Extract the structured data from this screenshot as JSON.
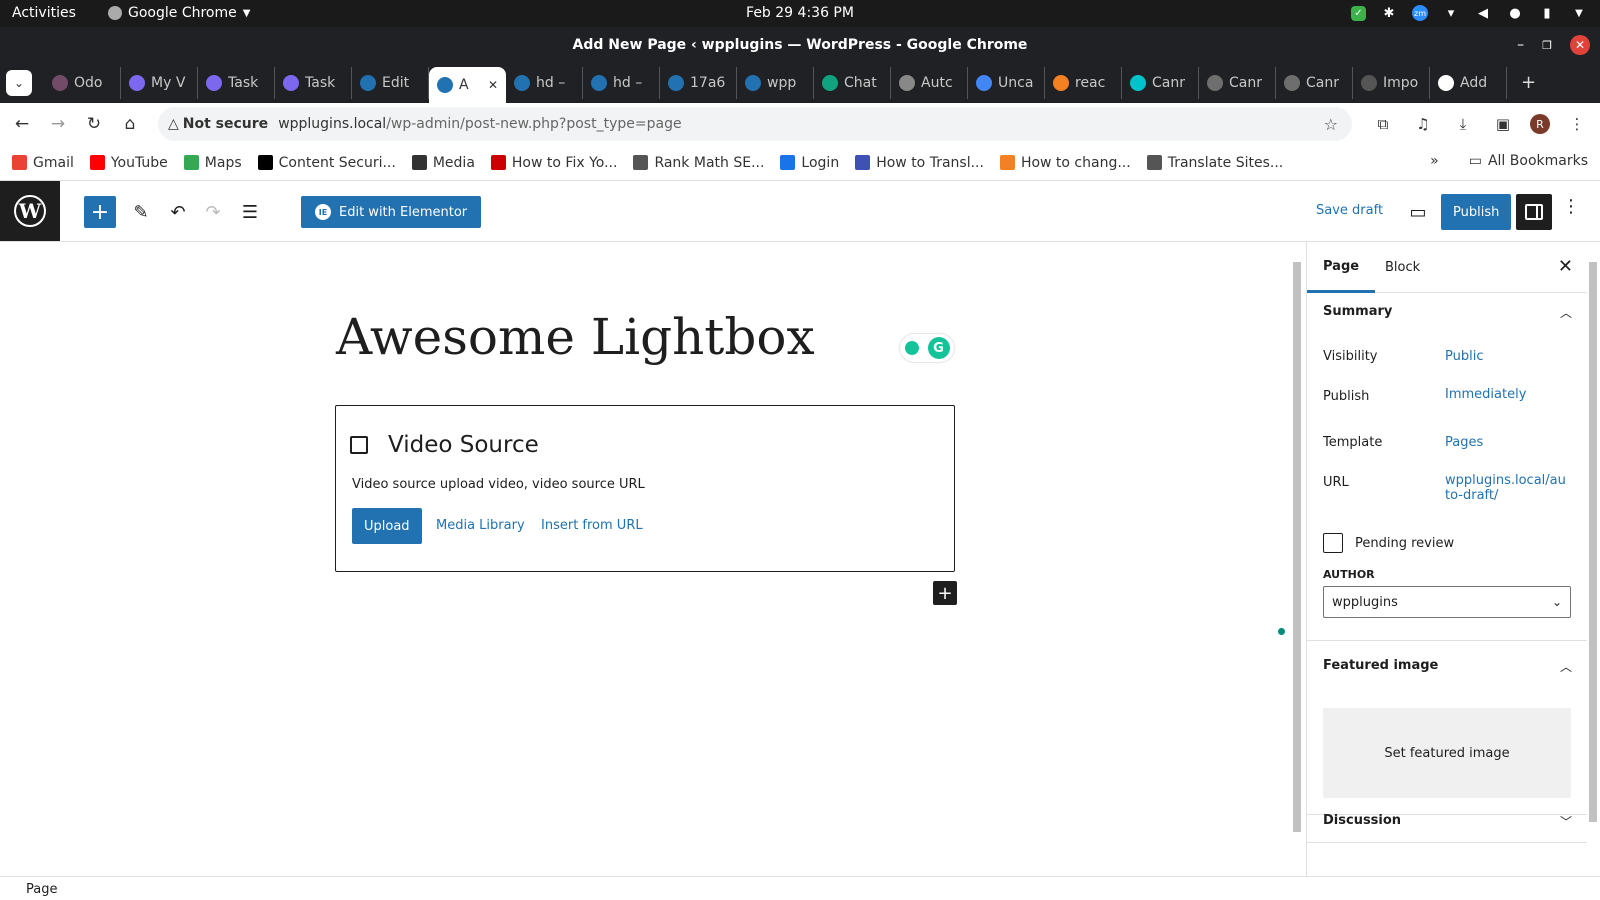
{
  "os_bar": {
    "activities": "Activities",
    "app_name": "Google Chrome",
    "clock": "Feb 29  4:36 PM"
  },
  "window": {
    "title": "Add New Page ‹ wpplugins — WordPress - Google Chrome"
  },
  "tabs": [
    {
      "label": "Odo",
      "icon": "odoo-icon",
      "color": "#714b67"
    },
    {
      "label": "My V",
      "icon": "clickup-icon",
      "color": "#7b68ee"
    },
    {
      "label": "Task",
      "icon": "clickup-icon",
      "color": "#7b68ee"
    },
    {
      "label": "Task",
      "icon": "clickup-icon",
      "color": "#7b68ee"
    },
    {
      "label": "Edit",
      "icon": "wordpress-icon",
      "color": "#2271b1"
    },
    {
      "label": "A",
      "icon": "wordpress-icon",
      "color": "#2271b1",
      "active": true
    },
    {
      "label": "hd –",
      "icon": "wordpress-icon",
      "color": "#2271b1"
    },
    {
      "label": "hd –",
      "icon": "wordpress-icon",
      "color": "#2271b1"
    },
    {
      "label": "17a6",
      "icon": "wordpress-icon",
      "color": "#2271b1"
    },
    {
      "label": "wpp",
      "icon": "wordpress-icon",
      "color": "#2271b1"
    },
    {
      "label": "Chat",
      "icon": "chatgpt-icon",
      "color": "#10a37f"
    },
    {
      "label": "Autc",
      "icon": "wordpress-icon",
      "color": "#888888"
    },
    {
      "label": "Unca",
      "icon": "google-icon",
      "color": "#4285f4"
    },
    {
      "label": "reac",
      "icon": "stackoverflow-icon",
      "color": "#f48024"
    },
    {
      "label": "Canr",
      "icon": "canva-icon",
      "color": "#00c4cc"
    },
    {
      "label": "Canr",
      "icon": "github-icon",
      "color": "#6e6e6e"
    },
    {
      "label": "Canr",
      "icon": "github-icon",
      "color": "#6e6e6e"
    },
    {
      "label": "Impo",
      "icon": "feather-icon",
      "color": "#555555"
    },
    {
      "label": "Add",
      "icon": "add-icon",
      "color": "#ffffff"
    }
  ],
  "omnibox": {
    "security_label": "Not secure",
    "url_host": "wpplugins.local",
    "url_path": "/wp-admin/post-new.php?post_type=page"
  },
  "bookmarks": [
    {
      "label": "Gmail",
      "icon": "gmail-icon",
      "color": "#ea4335"
    },
    {
      "label": "YouTube",
      "icon": "youtube-icon",
      "color": "#ff0000"
    },
    {
      "label": "Maps",
      "icon": "maps-icon",
      "color": "#34a853"
    },
    {
      "label": "Content Securi...",
      "icon": "medium-icon",
      "color": "#000000"
    },
    {
      "label": "Media",
      "icon": "media-icon",
      "color": "#333333"
    },
    {
      "label": "How to Fix Yo...",
      "icon": "bookmark-icon",
      "color": "#cc0000"
    },
    {
      "label": "Rank Math SE...",
      "icon": "is-icon",
      "color": "#555555"
    },
    {
      "label": "Login",
      "icon": "grid-icon",
      "color": "#1a73e8"
    },
    {
      "label": "How to Transl...",
      "icon": "translate-icon",
      "color": "#3f51b5"
    },
    {
      "label": "How to chang...",
      "icon": "stackoverflow-icon",
      "color": "#f48024"
    },
    {
      "label": "Translate Sites...",
      "icon": "loading-icon",
      "color": "#555555"
    }
  ],
  "bookmarks_right": {
    "more": "»",
    "all_bookmarks": "All Bookmarks"
  },
  "wp_toolbar": {
    "elementor_label": "Edit with Elementor",
    "save_draft": "Save draft",
    "publish": "Publish"
  },
  "editor": {
    "page_title": "Awesome Lightbox",
    "block": {
      "title": "Video Source",
      "description": "Video source upload video, video source URL",
      "upload": "Upload",
      "media_library": "Media Library",
      "insert_url": "Insert from URL"
    }
  },
  "sidebar": {
    "tab_page": "Page",
    "tab_block": "Block",
    "summary": "Summary",
    "rows": {
      "visibility_label": "Visibility",
      "visibility_value": "Public",
      "publish_label": "Publish",
      "publish_value": "Immediately",
      "template_label": "Template",
      "template_value": "Pages",
      "url_label": "URL",
      "url_value_line1": "wpplugins.local/au",
      "url_value_line2": "to-draft/"
    },
    "pending_review": "Pending review",
    "author_label": "AUTHOR",
    "author_value": "wpplugins",
    "featured_image": "Featured image",
    "set_featured_image": "Set featured image",
    "discussion": "Discussion"
  },
  "status_bar": {
    "breadcrumb": "Page"
  },
  "colors": {
    "wp_blue": "#2271b1",
    "dark": "#1e1e1e",
    "chrome_dark": "#202124"
  }
}
